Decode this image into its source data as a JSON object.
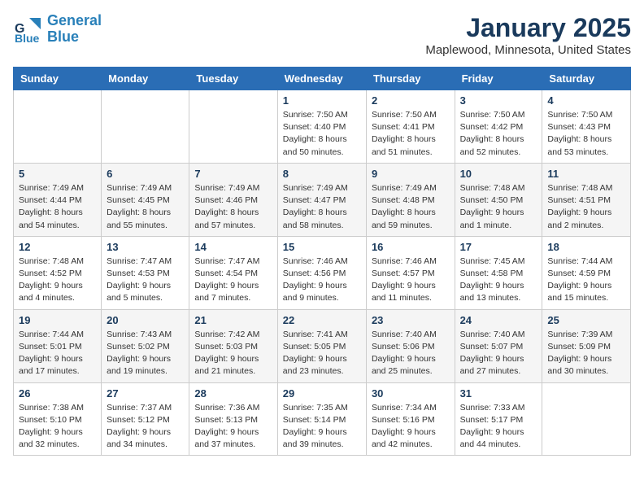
{
  "header": {
    "logo_line1": "General",
    "logo_line2": "Blue",
    "month": "January 2025",
    "location": "Maplewood, Minnesota, United States"
  },
  "weekdays": [
    "Sunday",
    "Monday",
    "Tuesday",
    "Wednesday",
    "Thursday",
    "Friday",
    "Saturday"
  ],
  "weeks": [
    [
      {
        "day": "",
        "info": ""
      },
      {
        "day": "",
        "info": ""
      },
      {
        "day": "",
        "info": ""
      },
      {
        "day": "1",
        "info": "Sunrise: 7:50 AM\nSunset: 4:40 PM\nDaylight: 8 hours\nand 50 minutes."
      },
      {
        "day": "2",
        "info": "Sunrise: 7:50 AM\nSunset: 4:41 PM\nDaylight: 8 hours\nand 51 minutes."
      },
      {
        "day": "3",
        "info": "Sunrise: 7:50 AM\nSunset: 4:42 PM\nDaylight: 8 hours\nand 52 minutes."
      },
      {
        "day": "4",
        "info": "Sunrise: 7:50 AM\nSunset: 4:43 PM\nDaylight: 8 hours\nand 53 minutes."
      }
    ],
    [
      {
        "day": "5",
        "info": "Sunrise: 7:49 AM\nSunset: 4:44 PM\nDaylight: 8 hours\nand 54 minutes."
      },
      {
        "day": "6",
        "info": "Sunrise: 7:49 AM\nSunset: 4:45 PM\nDaylight: 8 hours\nand 55 minutes."
      },
      {
        "day": "7",
        "info": "Sunrise: 7:49 AM\nSunset: 4:46 PM\nDaylight: 8 hours\nand 57 minutes."
      },
      {
        "day": "8",
        "info": "Sunrise: 7:49 AM\nSunset: 4:47 PM\nDaylight: 8 hours\nand 58 minutes."
      },
      {
        "day": "9",
        "info": "Sunrise: 7:49 AM\nSunset: 4:48 PM\nDaylight: 8 hours\nand 59 minutes."
      },
      {
        "day": "10",
        "info": "Sunrise: 7:48 AM\nSunset: 4:50 PM\nDaylight: 9 hours\nand 1 minute."
      },
      {
        "day": "11",
        "info": "Sunrise: 7:48 AM\nSunset: 4:51 PM\nDaylight: 9 hours\nand 2 minutes."
      }
    ],
    [
      {
        "day": "12",
        "info": "Sunrise: 7:48 AM\nSunset: 4:52 PM\nDaylight: 9 hours\nand 4 minutes."
      },
      {
        "day": "13",
        "info": "Sunrise: 7:47 AM\nSunset: 4:53 PM\nDaylight: 9 hours\nand 5 minutes."
      },
      {
        "day": "14",
        "info": "Sunrise: 7:47 AM\nSunset: 4:54 PM\nDaylight: 9 hours\nand 7 minutes."
      },
      {
        "day": "15",
        "info": "Sunrise: 7:46 AM\nSunset: 4:56 PM\nDaylight: 9 hours\nand 9 minutes."
      },
      {
        "day": "16",
        "info": "Sunrise: 7:46 AM\nSunset: 4:57 PM\nDaylight: 9 hours\nand 11 minutes."
      },
      {
        "day": "17",
        "info": "Sunrise: 7:45 AM\nSunset: 4:58 PM\nDaylight: 9 hours\nand 13 minutes."
      },
      {
        "day": "18",
        "info": "Sunrise: 7:44 AM\nSunset: 4:59 PM\nDaylight: 9 hours\nand 15 minutes."
      }
    ],
    [
      {
        "day": "19",
        "info": "Sunrise: 7:44 AM\nSunset: 5:01 PM\nDaylight: 9 hours\nand 17 minutes."
      },
      {
        "day": "20",
        "info": "Sunrise: 7:43 AM\nSunset: 5:02 PM\nDaylight: 9 hours\nand 19 minutes."
      },
      {
        "day": "21",
        "info": "Sunrise: 7:42 AM\nSunset: 5:03 PM\nDaylight: 9 hours\nand 21 minutes."
      },
      {
        "day": "22",
        "info": "Sunrise: 7:41 AM\nSunset: 5:05 PM\nDaylight: 9 hours\nand 23 minutes."
      },
      {
        "day": "23",
        "info": "Sunrise: 7:40 AM\nSunset: 5:06 PM\nDaylight: 9 hours\nand 25 minutes."
      },
      {
        "day": "24",
        "info": "Sunrise: 7:40 AM\nSunset: 5:07 PM\nDaylight: 9 hours\nand 27 minutes."
      },
      {
        "day": "25",
        "info": "Sunrise: 7:39 AM\nSunset: 5:09 PM\nDaylight: 9 hours\nand 30 minutes."
      }
    ],
    [
      {
        "day": "26",
        "info": "Sunrise: 7:38 AM\nSunset: 5:10 PM\nDaylight: 9 hours\nand 32 minutes."
      },
      {
        "day": "27",
        "info": "Sunrise: 7:37 AM\nSunset: 5:12 PM\nDaylight: 9 hours\nand 34 minutes."
      },
      {
        "day": "28",
        "info": "Sunrise: 7:36 AM\nSunset: 5:13 PM\nDaylight: 9 hours\nand 37 minutes."
      },
      {
        "day": "29",
        "info": "Sunrise: 7:35 AM\nSunset: 5:14 PM\nDaylight: 9 hours\nand 39 minutes."
      },
      {
        "day": "30",
        "info": "Sunrise: 7:34 AM\nSunset: 5:16 PM\nDaylight: 9 hours\nand 42 minutes."
      },
      {
        "day": "31",
        "info": "Sunrise: 7:33 AM\nSunset: 5:17 PM\nDaylight: 9 hours\nand 44 minutes."
      },
      {
        "day": "",
        "info": ""
      }
    ]
  ]
}
